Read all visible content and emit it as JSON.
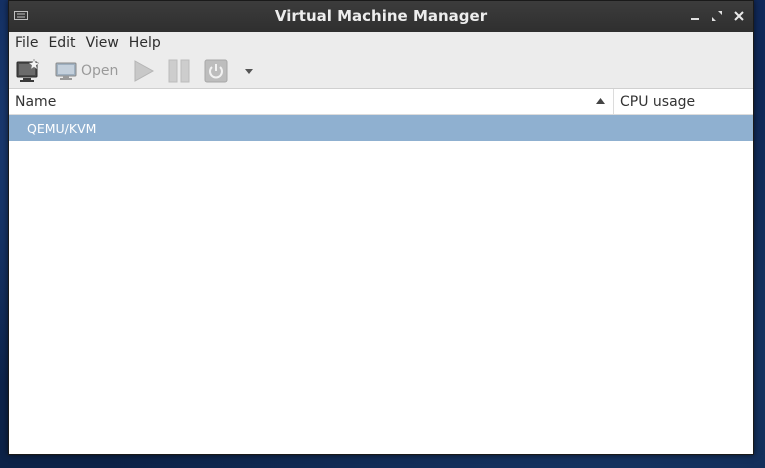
{
  "window": {
    "title": "Virtual Machine Manager"
  },
  "menu": [
    "File",
    "Edit",
    "View",
    "Help"
  ],
  "toolbar": {
    "open_label": "Open"
  },
  "columns": {
    "name": "Name",
    "cpu": "CPU usage"
  },
  "connections": [
    {
      "label": "QEMU/KVM",
      "selected": true
    }
  ],
  "colors": {
    "selection": "#8fb0d0",
    "titlebar": "#2f2f2f",
    "desktop": "#0f2a55"
  }
}
